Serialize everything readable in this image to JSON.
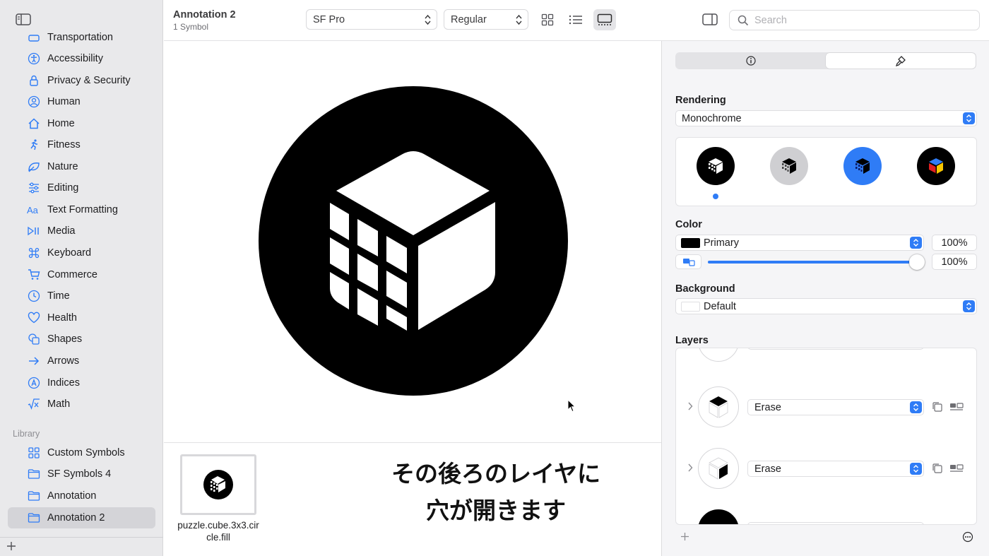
{
  "header": {
    "title": "Annotation 2",
    "subtitle": "1 Symbol",
    "font_popup": "SF Pro",
    "weight_popup": "Regular",
    "search_placeholder": "Search"
  },
  "sidebar": {
    "partial_item": "Transportation",
    "items": [
      {
        "label": "Accessibility",
        "icon": "accessibility-icon"
      },
      {
        "label": "Privacy & Security",
        "icon": "lock-icon"
      },
      {
        "label": "Human",
        "icon": "person-circle-icon"
      },
      {
        "label": "Home",
        "icon": "house-icon"
      },
      {
        "label": "Fitness",
        "icon": "running-figure-icon"
      },
      {
        "label": "Nature",
        "icon": "leaf-icon"
      },
      {
        "label": "Editing",
        "icon": "sliders-icon"
      },
      {
        "label": "Text Formatting",
        "icon": "textformat-icon"
      },
      {
        "label": "Media",
        "icon": "play-pause-icon"
      },
      {
        "label": "Keyboard",
        "icon": "command-icon"
      },
      {
        "label": "Commerce",
        "icon": "cart-icon"
      },
      {
        "label": "Time",
        "icon": "clock-icon"
      },
      {
        "label": "Health",
        "icon": "heart-icon"
      },
      {
        "label": "Shapes",
        "icon": "shapes-icon"
      },
      {
        "label": "Arrows",
        "icon": "arrow-right-icon"
      },
      {
        "label": "Indices",
        "icon": "a-circle-icon"
      },
      {
        "label": "Math",
        "icon": "square-root-icon"
      }
    ],
    "library_heading": "Library",
    "library_items": [
      {
        "label": "Custom Symbols",
        "icon": "grid-icon"
      },
      {
        "label": "SF Symbols 4",
        "icon": "folder-icon"
      },
      {
        "label": "Annotation",
        "icon": "folder-icon"
      },
      {
        "label": "Annotation 2",
        "icon": "folder-icon",
        "selected": true
      }
    ]
  },
  "canvas": {
    "symbol_icon": "puzzle-cube-circle-fill-icon"
  },
  "bottom": {
    "thumb_label": "puzzle.cube.3x3.circle.fill",
    "caption_line1": "その後ろのレイヤに",
    "caption_line2": "穴が開きます"
  },
  "inspector": {
    "tabs": [
      {
        "icon": "info-icon"
      },
      {
        "icon": "paintbrush-icon",
        "active": true
      }
    ],
    "rendering_label": "Rendering",
    "rendering_value": "Monochrome",
    "rendering_modes": [
      "monochrome",
      "hierarchical",
      "palette",
      "multicolor"
    ],
    "color_label": "Color",
    "color_value": "Primary",
    "color_swatch": "#000000",
    "color_opacity": "100%",
    "slider_opacity": "100%",
    "slider_level": 1.0,
    "background_label": "Background",
    "background_value": "Default",
    "layers_label": "Layers",
    "layers": [
      {
        "mode": "Erase",
        "part": "top"
      },
      {
        "mode": "Erase",
        "part": "right"
      }
    ]
  },
  "colors": {
    "accent": "#2f7cf6",
    "sidebar_bg": "#e9e9eb",
    "inspector_bg": "#f5f5f7"
  }
}
